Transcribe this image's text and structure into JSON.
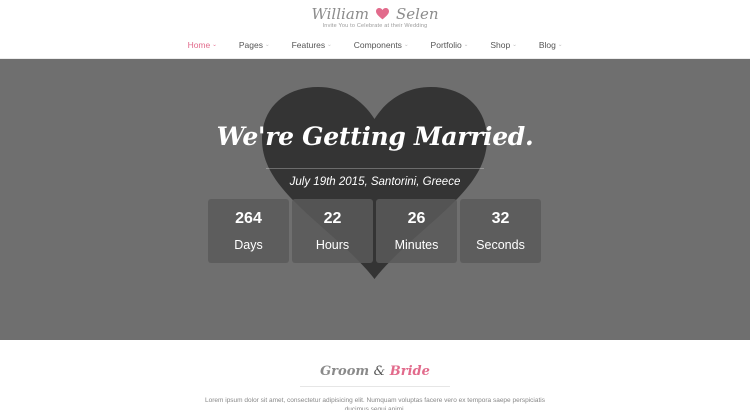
{
  "brand": {
    "groom_name": "William",
    "bride_name": "Selen",
    "tagline": "Invite You to Celebrate at their Wedding",
    "heart_color": "#e26b8c"
  },
  "nav": {
    "items": [
      {
        "label": "Home",
        "active": true
      },
      {
        "label": "Pages",
        "active": false
      },
      {
        "label": "Features",
        "active": false
      },
      {
        "label": "Components",
        "active": false
      },
      {
        "label": "Portfolio",
        "active": false
      },
      {
        "label": "Shop",
        "active": false
      },
      {
        "label": "Blog",
        "active": false
      }
    ],
    "active_color": "#e26b8c"
  },
  "hero": {
    "title": "We're Getting Married.",
    "subtitle": "July 19th 2015, Santorini, Greece",
    "background_color": "#6f6f6f",
    "heart_color": "#2f2f2f"
  },
  "countdown": [
    {
      "value": "264",
      "label": "Days"
    },
    {
      "value": "22",
      "label": "Hours"
    },
    {
      "value": "26",
      "label": "Minutes"
    },
    {
      "value": "32",
      "label": "Seconds"
    }
  ],
  "couple_section": {
    "title_groom": "Groom",
    "title_amp": "&",
    "title_bride": "Bride",
    "text": "Lorem ipsum dolor sit amet, consectetur adipisicing elit. Numquam voluptas facere vero ex tempora saepe perspiciatis ducimus sequi animi."
  }
}
